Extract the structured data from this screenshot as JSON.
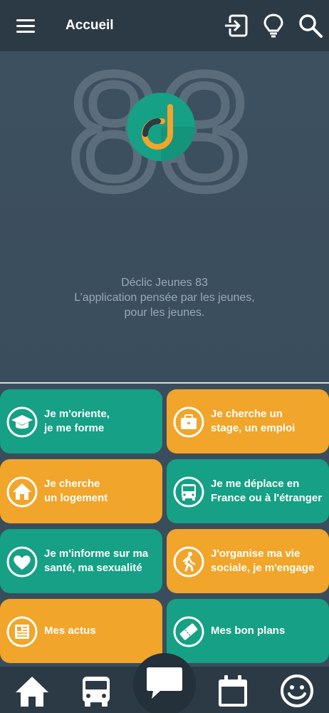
{
  "header": {
    "title": "Accueil",
    "icons": [
      "menu-icon",
      "login-icon",
      "lightbulb-icon",
      "search-icon"
    ]
  },
  "hero": {
    "background_number": "83",
    "tagline_line1": "Déclic Jeunes 83",
    "tagline_line2": "L’application pensée par les jeunes,",
    "tagline_line3": "pour les jeunes."
  },
  "tiles": [
    {
      "line1": "Je m'oriente,",
      "line2": "je me forme",
      "icon": "graduation-cap-icon",
      "color": "#16a085"
    },
    {
      "line1": "Je cherche un",
      "line2": "stage, un emploi",
      "icon": "briefcase-icon",
      "color": "#f1a52a"
    },
    {
      "line1": "Je cherche",
      "line2": "un logement",
      "icon": "house-icon",
      "color": "#f1a52a"
    },
    {
      "line1": "Je me déplace en",
      "line2": "France ou à l'étranger",
      "icon": "bus-icon",
      "color": "#16a085"
    },
    {
      "line1": "Je m'informe sur ma",
      "line2": "santé, ma sexualité",
      "icon": "heart-icon",
      "color": "#16a085"
    },
    {
      "line1": "J'organise ma vie",
      "line2": "sociale, je m'engage",
      "icon": "walking-person-icon",
      "color": "#f1a52a"
    },
    {
      "line1": "Mes actus",
      "line2": "",
      "icon": "newspaper-icon",
      "color": "#f1a52a"
    },
    {
      "line1": "Mes bon plans",
      "line2": "",
      "icon": "ticket-icon",
      "color": "#16a085"
    }
  ],
  "bottom_nav": {
    "items": [
      "home-icon",
      "bus-icon",
      "chat-icon",
      "calendar-icon",
      "smiley-icon"
    ]
  },
  "colors": {
    "green": "#16a085",
    "orange": "#f1a52a",
    "topbar": "#2c3a45",
    "background": "#3a4d5c"
  }
}
